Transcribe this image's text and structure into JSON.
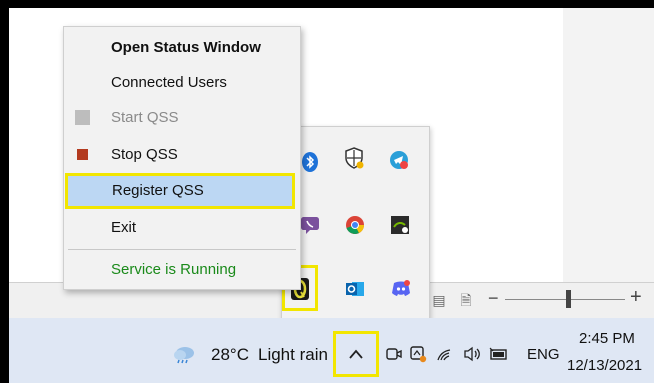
{
  "context_menu": {
    "items": [
      {
        "label": "Open Status Window"
      },
      {
        "label": "Connected Users"
      },
      {
        "label": "Start QSS"
      },
      {
        "label": "Stop QSS"
      },
      {
        "label": "Register QSS"
      },
      {
        "label": "Exit"
      }
    ],
    "status_text": "Service is Running"
  },
  "taskbar": {
    "weather_temp": "28°C",
    "weather_desc": "Light rain",
    "language": "ENG",
    "time": "2:45 PM",
    "date": "12/13/2021"
  },
  "tray_icons": [
    "bluetooth-icon",
    "security-shield-icon",
    "telegram-icon",
    "viber-icon",
    "chrome-icon",
    "nvidia-icon",
    "qss-tray-icon",
    "outlook-icon",
    "discord-icon"
  ],
  "colors": {
    "highlight": "#f2e600",
    "menu_selected": "#bcd7f3",
    "status_green": "#1a8a1a",
    "stop_red": "#b33a1f"
  }
}
